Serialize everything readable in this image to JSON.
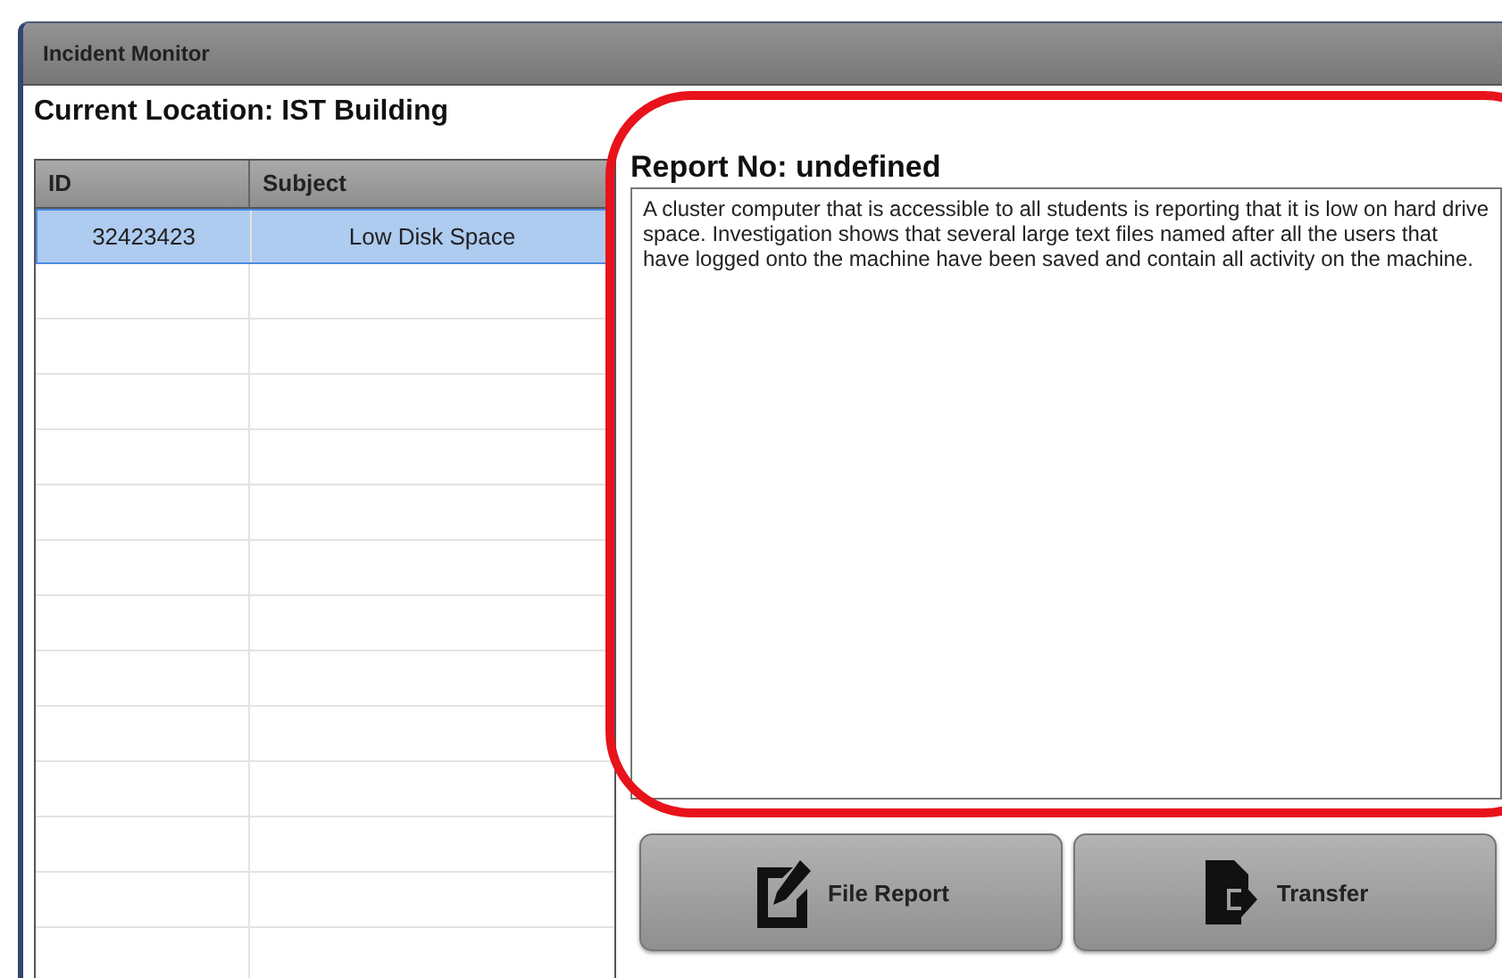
{
  "window": {
    "title": "Incident Monitor"
  },
  "location": "Current Location: IST Building",
  "table": {
    "columns": [
      "ID",
      "Subject"
    ],
    "rows": [
      {
        "cells": [
          "32423423",
          "Low Disk Space"
        ],
        "selected": true
      }
    ]
  },
  "report": {
    "title": "Report No: undefined",
    "text": "A cluster computer that is accessible to all students is reporting that it is low on hard drive space. Investigation shows that several large text files named after all the users that have logged onto the machine have been saved and contain all activity on the machine."
  },
  "buttons": [
    {
      "label": "File Report",
      "kind": "edit"
    },
    {
      "label": "Transfer",
      "kind": "transfer"
    }
  ],
  "annotation": {
    "kind": "outline"
  }
}
